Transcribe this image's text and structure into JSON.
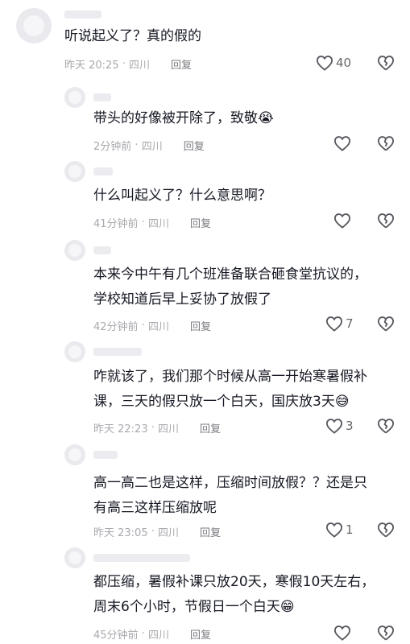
{
  "comments": [
    {
      "text": "听说起义了？真的假的",
      "time": "昨天 20:25",
      "location": "四川",
      "reply": "回复",
      "likes": "40"
    },
    {
      "text": "带头的好像被开除了，致敬😭",
      "time": "2分钟前",
      "location": "四川",
      "reply": "回复",
      "likes": ""
    },
    {
      "text": "什么叫起义了？什么意思啊？",
      "time": "41分钟前",
      "location": "四川",
      "reply": "回复",
      "likes": ""
    },
    {
      "text_line1": "本来今中午有几个班准备联合砸食堂抗议的，",
      "text_line2": "学校知道后早上妥协了放假了",
      "time": "42分钟前",
      "location": "四川",
      "reply": "回复",
      "likes": "7"
    },
    {
      "text_line1": "咋就该了，我们那个时候从高一开始寒暑假补",
      "text_line2": "课，三天的假只放一个白天，国庆放3天😅",
      "time": "昨天 22:23",
      "location": "四川",
      "reply": "回复",
      "likes": "3"
    },
    {
      "text_line1": "高一高二也是这样，压缩时间放假？？还是只",
      "text_line2": "有高三这样压缩放呢",
      "time": "昨天 23:05",
      "location": "四川",
      "reply": "回复",
      "likes": "1"
    },
    {
      "text_line1": "都压缩，暑假补课只放20天，寒假10天左右，",
      "text_line2": "周末6个小时，节假日一个白天😁",
      "time": "45分钟前",
      "location": "四川",
      "reply": "回复",
      "likes": ""
    }
  ],
  "icons": {
    "like": "heart-outline-icon",
    "dislike": "broken-heart-icon"
  }
}
